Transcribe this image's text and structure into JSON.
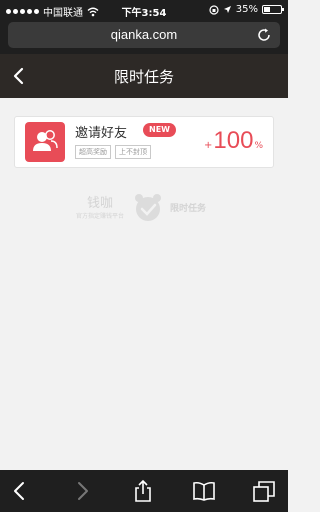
{
  "status_bar": {
    "carrier": "中国联通",
    "time": "下午3:54",
    "battery_percent": "35%",
    "battery_level": 0.35
  },
  "browser": {
    "url": "qianka.com"
  },
  "header": {
    "title": "限时任务"
  },
  "task_card": {
    "title": "邀请好友",
    "badge": "NEW",
    "tags": [
      "超高奖励",
      "上不封顶"
    ],
    "reward_prefix": "+",
    "reward_value": "100",
    "reward_unit": "%"
  },
  "watermark": {
    "brand": "钱咖",
    "tagline": "官方指定赚钱平台",
    "right": "限时任务"
  },
  "colors": {
    "accent": "#e84c57",
    "nav_bg": "#2d2926",
    "browser_bg": "#1f1f1f",
    "page_bg": "#f2f2f2"
  },
  "icons": {
    "status": [
      "signal-dots-icon",
      "wifi-icon",
      "lock-rotation-icon",
      "location-icon",
      "battery-icon"
    ],
    "browser": [
      "reload-icon"
    ],
    "header": [
      "back-chevron-icon"
    ],
    "card": [
      "users-icon"
    ],
    "watermark": [
      "alarm-clock-icon"
    ],
    "toolbar": [
      "back-arrow-icon",
      "forward-arrow-icon",
      "share-icon",
      "bookmarks-icon",
      "tabs-icon"
    ]
  }
}
